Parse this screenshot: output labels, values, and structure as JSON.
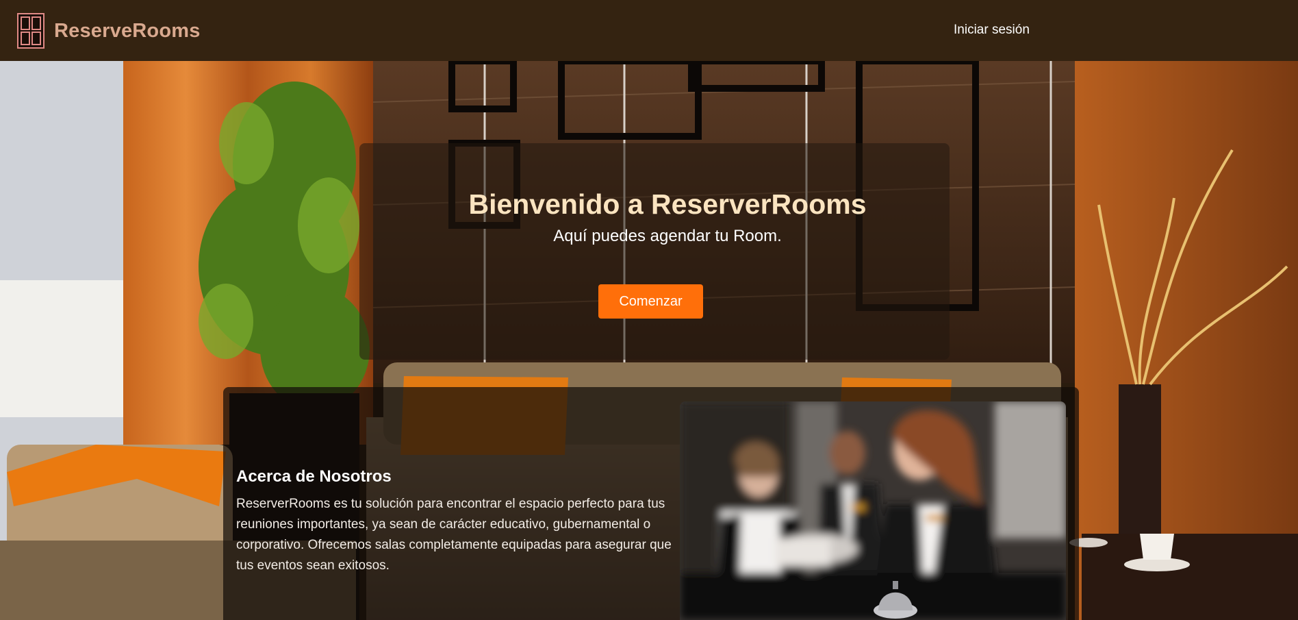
{
  "navbar": {
    "brand_name": "ReserveRooms",
    "logo_icon": "door-icon",
    "login_label": "Iniciar sesión"
  },
  "hero": {
    "title": "Bienvenido a ReserverRooms",
    "subtitle": "Aquí puedes agendar tu Room.",
    "cta_label": "Comenzar"
  },
  "about": {
    "title": "Acerca de Nosotros",
    "text": "ReserverRooms es tu solución para encontrar el espacio perfecto para tus reuniones importantes, ya sean de carácter educativo, gubernamental o corporativo. Ofrecemos salas completamente equipadas para asegurar que tus eventos sean exitosos."
  },
  "colors": {
    "navbar_bg": "#342311",
    "brand_text": "#d9a98f",
    "accent": "#ff6f0a",
    "title_text": "#fbe4c0"
  }
}
